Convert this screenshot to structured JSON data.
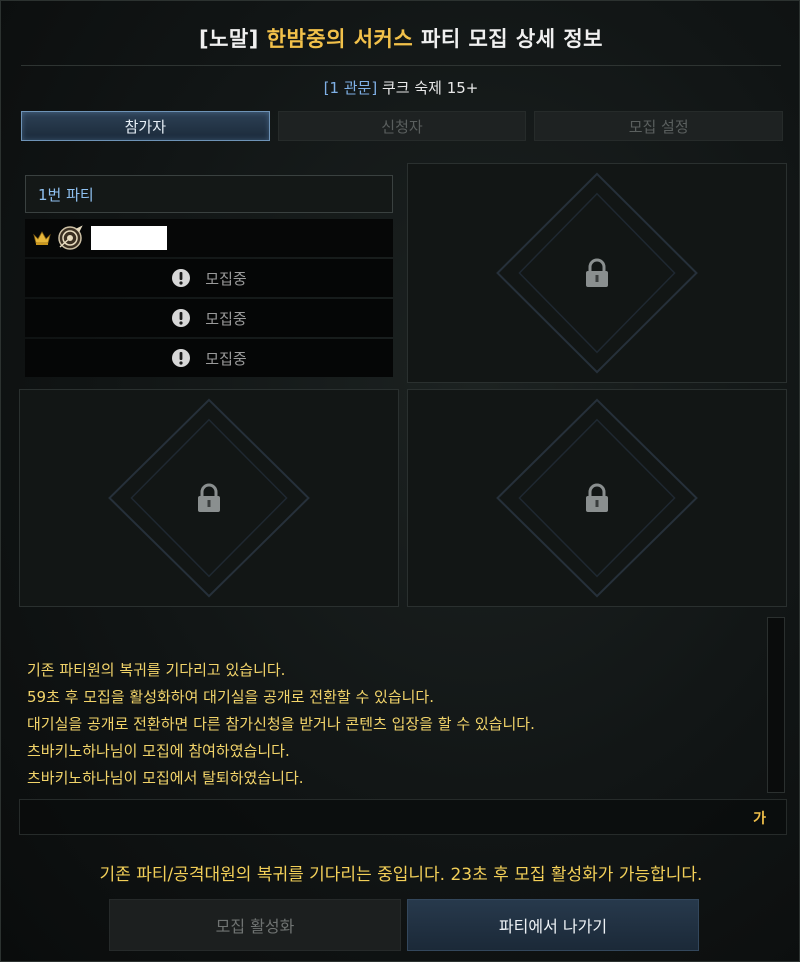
{
  "window": {
    "title_prefix": "[노말] ",
    "title_accent": "한밤중의 서커스",
    "title_suffix": " 파티 모집 상세 정보",
    "subtitle_bracket": "[1 관문]",
    "subtitle_text": " 쿠크 숙제 15+"
  },
  "tabs": [
    {
      "label": "참가자",
      "active": true
    },
    {
      "label": "신청자",
      "active": false
    },
    {
      "label": "모집 설정",
      "active": false
    }
  ],
  "party": {
    "header": "1번 파티",
    "recruiting_label": "모집중",
    "open_slots": 3
  },
  "log": {
    "lines": [
      "기존 파티원의 복귀를 기다리고 있습니다.",
      "59초 후 모집을 활성화하여 대기실을 공개로 전환할 수 있습니다.",
      "대기실을 공개로 전환하면 다른 참가신청을 받거나 콘텐츠 입장을 할 수 있습니다.",
      "츠바키노하나님이 모집에 참여하였습니다.",
      "츠바키노하나님이 모집에서 탈퇴하였습니다."
    ]
  },
  "chat": {
    "lang_label": "가"
  },
  "notice": "기존 파티/공격대원의 복귀를 기다리는 중입니다. 23초 후 모집 활성화가 가능합니다.",
  "buttons": {
    "activate_label": "모집 활성화",
    "leave_label": "파티에서 나가기"
  },
  "colors": {
    "accent_gold": "#f2c14a",
    "party_blue": "#8fc0f0",
    "log_yellow": "#f2d46a"
  },
  "icons": {
    "leader": "crown-icon",
    "class": "class-emblem-icon",
    "recruit": "exclamation-icon",
    "locked": "lock-icon"
  }
}
